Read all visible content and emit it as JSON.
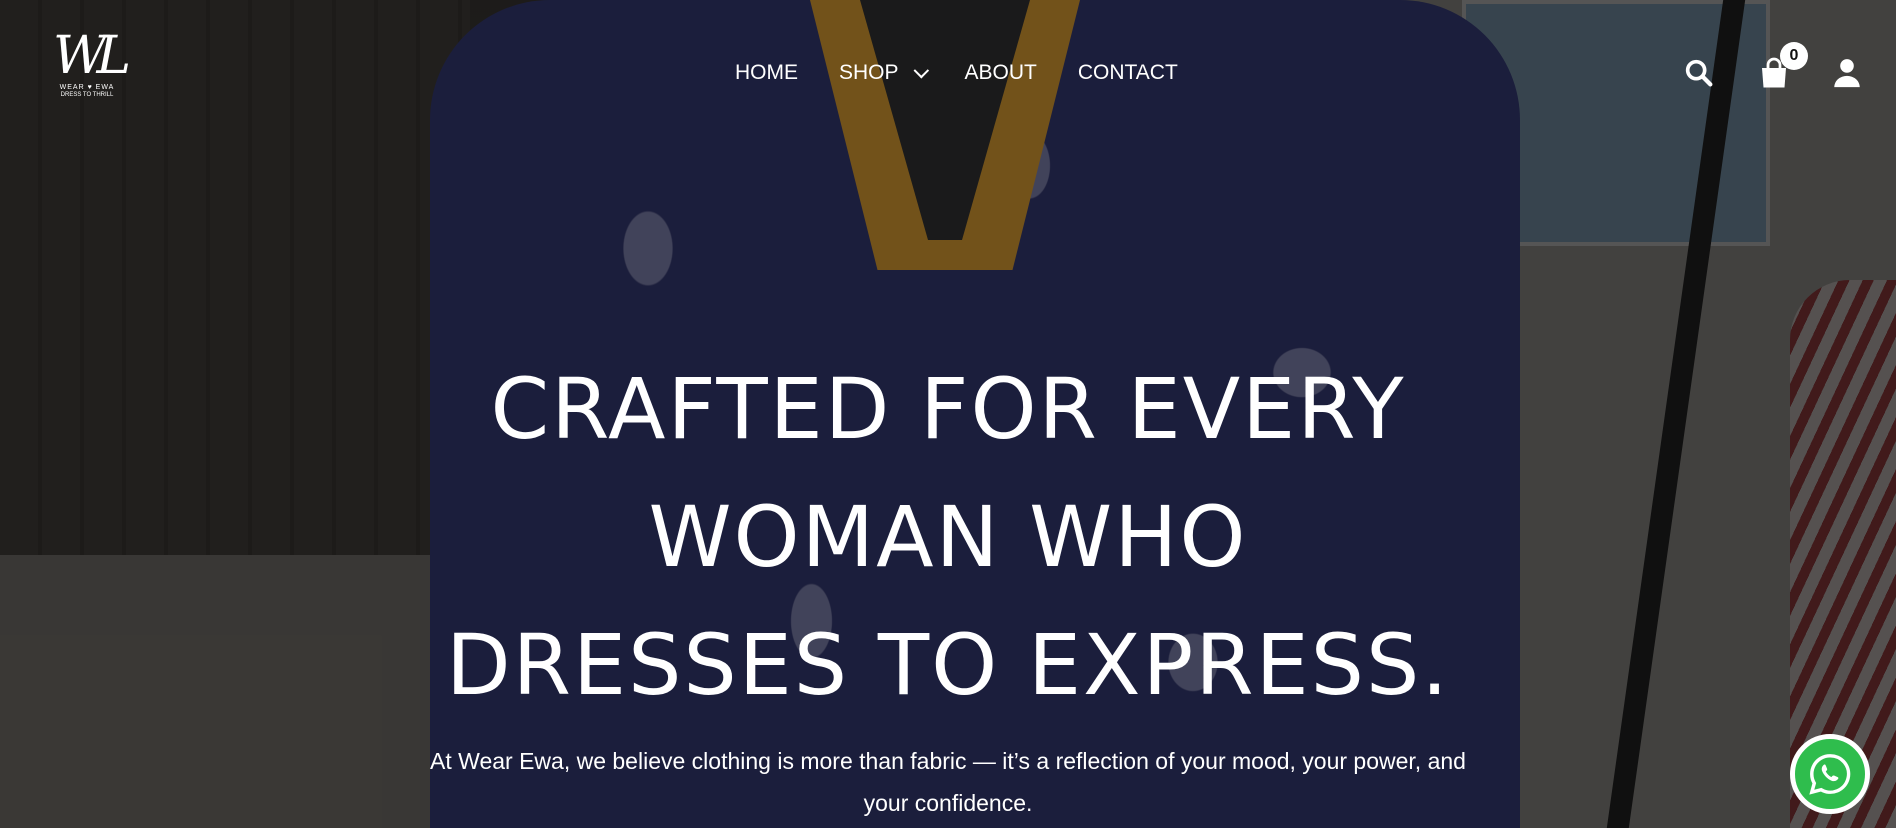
{
  "brand": {
    "logo_mark": "WL",
    "logo_line": "WEAR ♥ EWA",
    "logo_tagline": "DRESS TO THRILL"
  },
  "nav": {
    "items": [
      {
        "label": "HOME"
      },
      {
        "label": "SHOP",
        "has_dropdown": true
      },
      {
        "label": "ABOUT"
      },
      {
        "label": "CONTACT"
      }
    ]
  },
  "header_icons": {
    "search": "search-icon",
    "cart": "shopping-bag-icon",
    "cart_count": "0",
    "account": "user-icon"
  },
  "hero": {
    "headline_lines": [
      "CRAFTED FOR EVERY",
      "WOMAN WHO",
      "DRESSES TO EXPRESS."
    ],
    "lede": "At Wear Ewa, we believe clothing is more than fabric — it’s a reflection of your mood, your power, and your confidence."
  },
  "floating": {
    "whatsapp": "whatsapp-icon",
    "whatsapp_color": "#2fbd4d"
  }
}
